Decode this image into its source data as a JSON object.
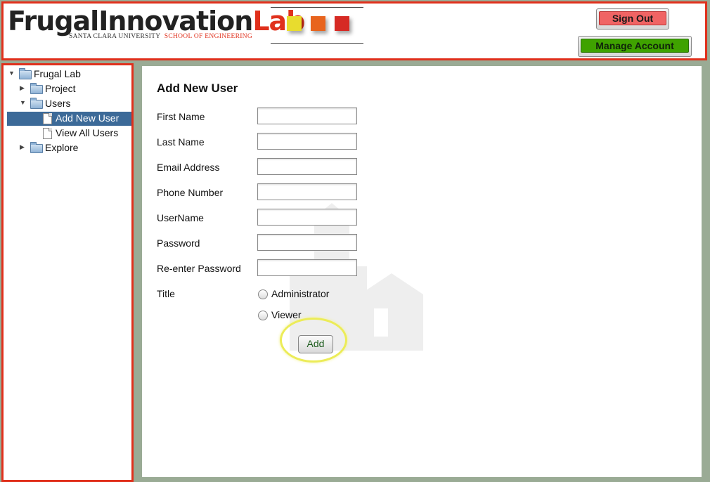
{
  "header": {
    "logo_main": "FrugalInnovation",
    "logo_accent": "Lab",
    "logo_sub_university": "SANTA CLARA UNIVERSITY",
    "logo_sub_school": "SCHOOL OF ENGINEERING",
    "logo_colors": [
      "#e8dc2e",
      "#e8641e",
      "#d62a24"
    ],
    "sign_out_label": "Sign Out",
    "manage_account_label": "Manage Account"
  },
  "sidebar": {
    "tree": {
      "root": "Frugal Lab",
      "project": "Project",
      "users": "Users",
      "add_new_user": "Add New User",
      "view_all_users": "View All Users",
      "explore": "Explore"
    }
  },
  "form": {
    "title": "Add New User",
    "fields": {
      "first_name": {
        "label": "First Name",
        "value": ""
      },
      "last_name": {
        "label": "Last Name",
        "value": ""
      },
      "email": {
        "label": "Email Address",
        "value": ""
      },
      "phone": {
        "label": "Phone Number",
        "value": ""
      },
      "username": {
        "label": "UserName",
        "value": ""
      },
      "password": {
        "label": "Password",
        "value": ""
      },
      "password_confirm": {
        "label": "Re-enter Password",
        "value": ""
      }
    },
    "title_label": "Title",
    "title_options": [
      "Administrator",
      "Viewer"
    ],
    "add_label": "Add"
  },
  "colors": {
    "accent_red": "#e0301c",
    "selected_row": "#3c6a98",
    "background": "#9aab95"
  }
}
